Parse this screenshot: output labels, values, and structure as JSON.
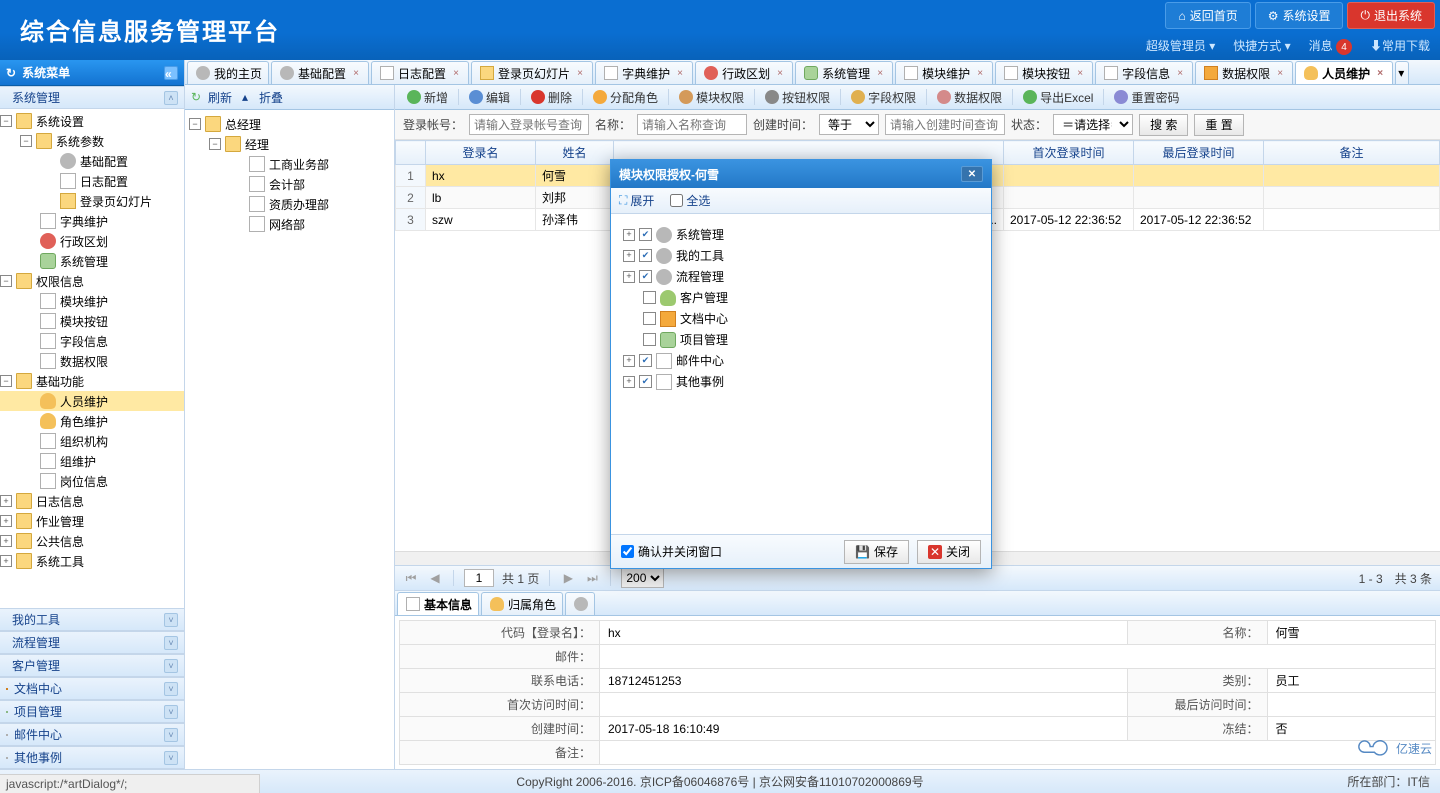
{
  "header": {
    "title": "综合信息服务管理平台",
    "btn_home": "返回首页",
    "btn_settings": "系统设置",
    "btn_exit": "退出系统",
    "user": "超级管理员",
    "quickway": "快捷方式",
    "msg": "消息",
    "msg_count": "4",
    "downloads": "常用下载"
  },
  "leftnav": {
    "title": "系统菜单",
    "sys_mgmt": "系统管理",
    "sys_settings": "系统设置",
    "sys_params": "系统参数",
    "base_cfg": "基础配置",
    "log_cfg": "日志配置",
    "login_slides": "登录页幻灯片",
    "dict_maint": "字典维护",
    "admin_area": "行政区划",
    "sys_mgmt2": "系统管理",
    "perm_info": "权限信息",
    "module_maint": "模块维护",
    "module_btn": "模块按钮",
    "field_info": "字段信息",
    "data_perm": "数据权限",
    "base_func": "基础功能",
    "person_maint": "人员维护",
    "role_maint": "角色维护",
    "org_struct": "组织机构",
    "org_maint": "组维护",
    "post_info": "岗位信息",
    "log_info": "日志信息",
    "job_mgmt": "作业管理",
    "public_info": "公共信息",
    "sys_tools": "系统工具",
    "acc_mytools": "我的工具",
    "acc_flow": "流程管理",
    "acc_cust": "客户管理",
    "acc_doc": "文档中心",
    "acc_proj": "项目管理",
    "acc_mail": "邮件中心",
    "acc_other": "其他事例"
  },
  "tabs": {
    "t0": "我的主页",
    "t1": "基础配置",
    "t2": "日志配置",
    "t3": "登录页幻灯片",
    "t4": "字典维护",
    "t5": "行政区划",
    "t6": "系统管理",
    "t7": "模块维护",
    "t8": "模块按钮",
    "t9": "字段信息",
    "t10": "数据权限",
    "t11": "人员维护"
  },
  "org": {
    "tb_refresh": "刷新",
    "tb_collapse": "折叠",
    "root": "总经理",
    "mgr": "经理",
    "d1": "工商业务部",
    "d2": "会计部",
    "d3": "资质办理部",
    "d4": "网络部"
  },
  "toolbar": {
    "add": "新增",
    "edit": "编辑",
    "del": "删除",
    "assign": "分配角色",
    "mod": "模块权限",
    "btnp": "按钮权限",
    "field": "字段权限",
    "datap": "数据权限",
    "excel": "导出Excel",
    "pwd": "重置密码"
  },
  "search": {
    "l_login": "登录帐号：",
    "ph_login": "请输入登录帐号查询",
    "l_name": "名称：",
    "ph_name": "请输入名称查询",
    "l_ctime": "创建时间：",
    "op": "等于",
    "ph_ctime": "请输入创建时间查询",
    "l_state": "状态：",
    "state_val": "＝请选择＝",
    "btn_search": "搜 索",
    "btn_reset": "重 置"
  },
  "grid": {
    "cols": {
      "login": "登录名",
      "name": "姓名",
      "first_login": "首次登录时间",
      "last_login": "最后登录时间",
      "remark": "备注"
    },
    "rows": [
      {
        "n": "1",
        "login": "hx",
        "name": "何雪",
        "first": "",
        "last": "",
        "remark": ""
      },
      {
        "n": "2",
        "login": "lb",
        "name": "刘邦",
        "first": "",
        "last": "",
        "remark": ""
      },
      {
        "n": "3",
        "login": "szw",
        "name": "孙泽伟",
        "first": "2017-05-12 22:36:52",
        "last": "2017-05-12 22:36:52",
        "remark": ""
      }
    ],
    "pager": {
      "page": "1",
      "of": "共 1 页",
      "size": "200",
      "info": "1 - 3　共 3 条"
    }
  },
  "dtabs": {
    "t0": "基本信息",
    "t1": "归属角色"
  },
  "detail": {
    "code_lbl": "代码【登录名】：",
    "code": "hx",
    "name_lbl": "名称：",
    "name": "何雪",
    "mail_lbl": "邮件：",
    "mail": "",
    "tel_lbl": "联系电话：",
    "tel": "18712451253",
    "type_lbl": "类别：",
    "type": "员工",
    "first_lbl": "首次访问时间：",
    "first": "",
    "last_lbl": "最后访问时间：",
    "last": "",
    "ctime_lbl": "创建时间：",
    "ctime": "2017-05-18 16:10:49",
    "frozen_lbl": "冻结：",
    "frozen": "否",
    "remark_lbl": "备注："
  },
  "dialog": {
    "title": "模块权限授权-何雪",
    "expand": "展开",
    "selectall": "全选",
    "tree": {
      "sys": "系统管理",
      "tools": "我的工具",
      "flow": "流程管理",
      "cust": "客户管理",
      "doc": "文档中心",
      "proj": "项目管理",
      "mail": "邮件中心",
      "other": "其他事例"
    },
    "confirm_close": "确认并关闭窗口",
    "save": "保存",
    "close": "关闭"
  },
  "footer": {
    "copy": "CopyRight 2006-2016. 京ICP备06046876号 | 京公网安备11010702000869号",
    "dept": "所在部门：IT信",
    "watermark": "亿速云"
  },
  "status": "javascript:/*artDialog*/;"
}
